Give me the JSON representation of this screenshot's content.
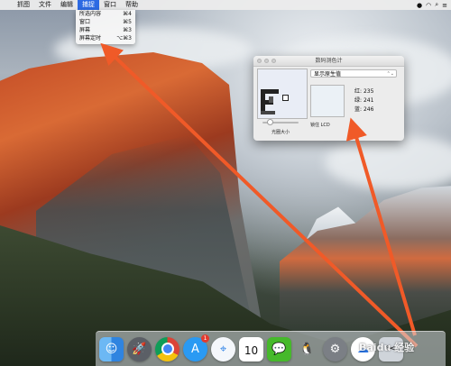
{
  "menubar": {
    "apple_icon": "apple-icon",
    "items": [
      {
        "label": "抓图"
      },
      {
        "label": "文件"
      },
      {
        "label": "编辑"
      },
      {
        "label": "捕捉"
      },
      {
        "label": "窗口"
      },
      {
        "label": "帮助"
      }
    ],
    "status_icons": [
      "wechat-icon",
      "wifi-icon",
      "search-icon",
      "list-icon"
    ]
  },
  "capture_menu": {
    "items": [
      {
        "label": "所选内容",
        "shortcut": "⌘4"
      },
      {
        "label": "窗口",
        "shortcut": "⌘5"
      },
      {
        "label": "屏幕",
        "shortcut": "⌘3"
      },
      {
        "label": "屏幕定时",
        "shortcut": "⌥⌘3"
      }
    ]
  },
  "color_meter": {
    "title": "数码测色计",
    "mode_select": "显示原生值",
    "aperture_label": "光圈大小",
    "lock_label": "锁住 LCD",
    "red_label": "红:",
    "red_value": "235",
    "green_label": "绿:",
    "green_value": "241",
    "blue_label": "蓝:",
    "blue_value": "246",
    "swatch_color": "#ebf1f6"
  },
  "dock": {
    "apps": [
      {
        "name": "finder-icon"
      },
      {
        "name": "launchpad-icon"
      },
      {
        "name": "chrome-icon"
      },
      {
        "name": "app-store-icon",
        "badge": "1"
      },
      {
        "name": "safari-icon"
      },
      {
        "name": "calendar-icon",
        "day": "10"
      },
      {
        "name": "wechat-icon"
      },
      {
        "name": "qq-icon"
      },
      {
        "name": "system-preferences-icon"
      },
      {
        "name": "baidu-netdisk-icon"
      },
      {
        "name": "screenshot-tool-icon"
      }
    ]
  },
  "watermark": "Baidu 经验",
  "colors": {
    "menu_highlight": "#2d6ae3",
    "arrow": "#f05a28"
  }
}
